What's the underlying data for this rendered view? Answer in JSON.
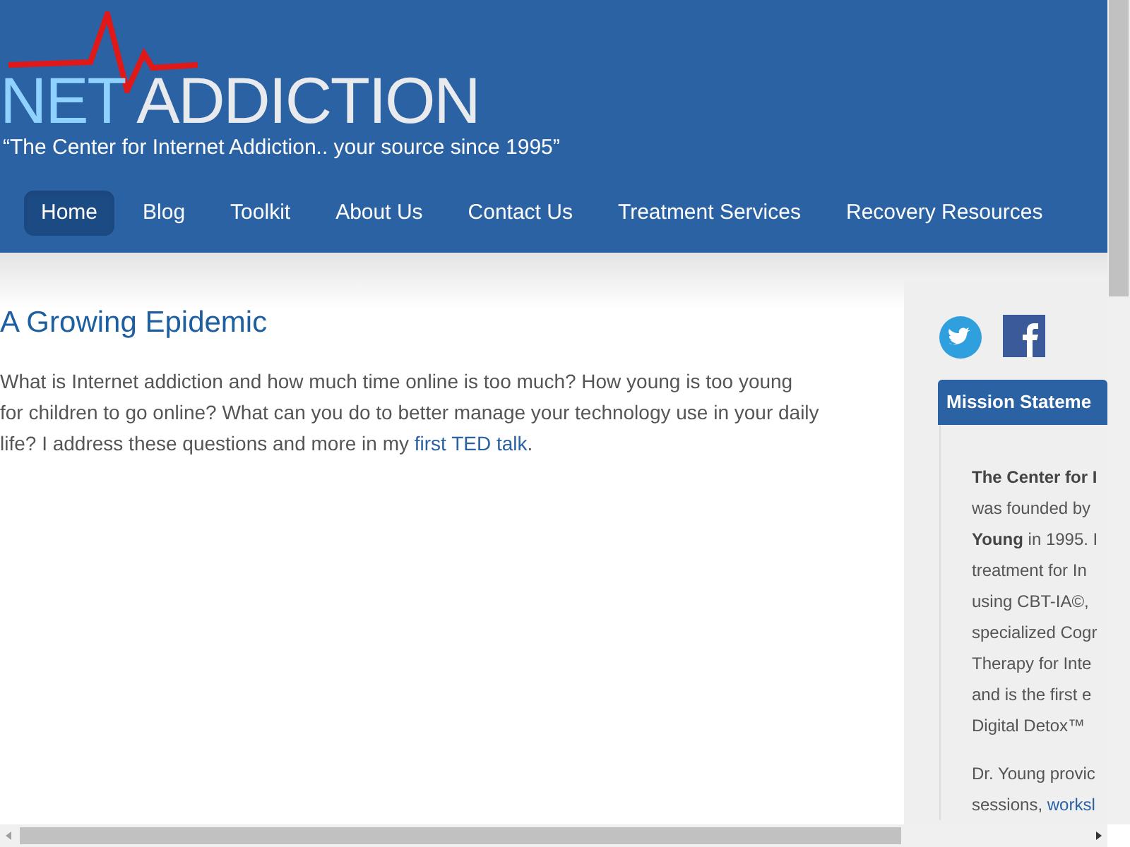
{
  "logo": {
    "word_1": "NET",
    "word_2": "ADDICTION",
    "tagline": "“The Center for Internet Addiction.. your source since 1995”"
  },
  "nav": [
    {
      "label": "Home",
      "selected": true
    },
    {
      "label": "Blog",
      "selected": false
    },
    {
      "label": "Toolkit",
      "selected": false
    },
    {
      "label": "About Us",
      "selected": false
    },
    {
      "label": "Contact Us",
      "selected": false
    },
    {
      "label": "Treatment Services",
      "selected": false
    },
    {
      "label": "Recovery Resources",
      "selected": false
    }
  ],
  "article": {
    "title": "A Growing Epidemic",
    "text": "What is Internet addiction and how much time online is too much? How young is too young for children to go online? What can you do to better manage your technology use in your daily life? I address these questions and more in my",
    "link": "first TED talk",
    "end": "."
  },
  "sidebar": {
    "social": [
      {
        "kind": "twitter"
      },
      {
        "kind": "facebook"
      }
    ],
    "heading": "Mission Stateme",
    "paragraphs": [
      [
        [
          {
            "kind": "bold",
            "text": "The Center for I"
          }
        ],
        [
          {
            "kind": "plain",
            "text": "was founded by"
          }
        ],
        [
          {
            "kind": "bold",
            "text": "Young"
          },
          {
            "kind": "plain",
            "text": " in 1995. I"
          }
        ],
        [
          {
            "kind": "plain",
            "text": "treatment for In"
          }
        ],
        [
          {
            "kind": "plain",
            "text": "using CBT-IA©, "
          }
        ],
        [
          {
            "kind": "plain",
            "text": "specialized Cogr"
          }
        ],
        [
          {
            "kind": "plain",
            "text": "Therapy for Inte"
          }
        ],
        [
          {
            "kind": "plain",
            "text": "and is the first e"
          }
        ],
        [
          {
            "kind": "plain",
            "text": "Digital Detox™"
          }
        ]
      ],
      [
        [
          {
            "kind": "plain",
            "text": "Dr. Young provic"
          }
        ],
        [
          {
            "kind": "plain",
            "text": "sessions, "
          },
          {
            "kind": "link",
            "text": "worksl"
          }
        ]
      ]
    ]
  }
}
